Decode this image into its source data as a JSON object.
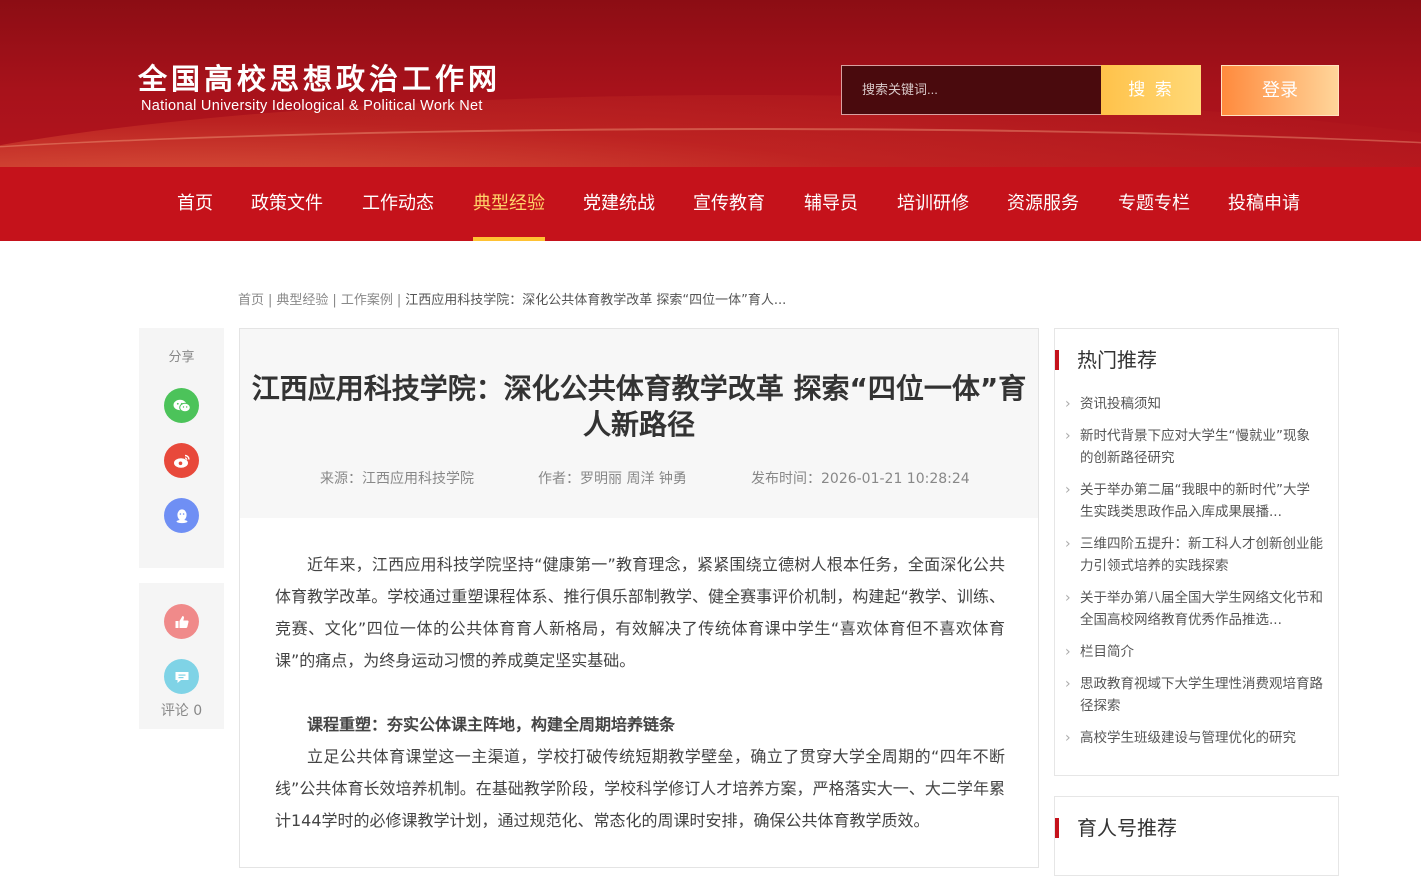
{
  "header": {
    "logo_cn": "全国高校思想政治工作网",
    "logo_en": "National University Ideological & Political Work Net",
    "search_placeholder": "搜索关键词...",
    "search_button": "搜 索",
    "login_button": "登录"
  },
  "nav": {
    "items": [
      "首页",
      "政策文件",
      "工作动态",
      "典型经验",
      "党建统战",
      "宣传教育",
      "辅导员",
      "培训研修",
      "资源服务",
      "专题专栏",
      "投稿申请"
    ],
    "active": "典型经验"
  },
  "breadcrumb": {
    "items": [
      "首页",
      "典型经验",
      "工作案例"
    ],
    "current": "江西应用科技学院：深化公共体育教学改革 探索“四位一体”育人..."
  },
  "share": {
    "label": "分享",
    "icons": [
      "wechat-icon",
      "weibo-icon",
      "qq-icon"
    ],
    "like_icon": "thumbs-up-icon",
    "comment_icon": "comment-icon",
    "comment_label": "评论 0"
  },
  "article": {
    "title": "江西应用科技学院：深化公共体育教学改革 探索“四位一体”育人新路径",
    "source": "来源：江西应用科技学院",
    "author": "作者：罗明丽 周洋 钟勇",
    "published": "发布时间：2026-01-21 10:28:24",
    "paragraphs": [
      "近年来，江西应用科技学院坚持“健康第一”教育理念，紧紧围绕立德树人根本任务，全面深化公共体育教学改革。学校通过重塑课程体系、推行俱乐部制教学、健全赛事评价机制，构建起“教学、训练、竞赛、文化”四位一体的公共体育育人新格局，有效解决了传统体育课中学生“喜欢体育但不喜欢体育课”的痛点，为终身运动习惯的养成奠定坚实基础。",
      "课程重塑：夯实公体课主阵地，构建全周期培养链条",
      "立足公共体育课堂这一主渠道，学校打破传统短期教学壁垒，确立了贯穿大学全周期的“四年不断线”公共体育长效培养机制。在基础教学阶段，学校科学修订人才培养方案，严格落实大一、大二学年累计144学时的必修课教学计划，通过规范化、常态化的周课时安排，确保公共体育教学质效。"
    ]
  },
  "sidebar": {
    "hot_title": "热门推荐",
    "hot_items": [
      "资讯投稿须知",
      "新时代背景下应对大学生“慢就业”现象的创新路径研究",
      "关于举办第二届“我眼中的新时代”大学生实践类思政作品入库成果展播...",
      "三维四阶五提升：新工科人才创新创业能力引领式培养的实践探索",
      "关于举办第八届全国大学生网络文化节和全国高校网络教育优秀作品推选...",
      "栏目简介",
      "思政教育视域下大学生理性消费观培育路径探索",
      "高校学生班级建设与管理优化的研究"
    ],
    "second_title": "育人号推荐"
  },
  "colors": {
    "brand_red": "#c5121b",
    "header_dark_red": "#8c0d14",
    "nav_active": "#ffd36a",
    "search_button": "#ffc24a",
    "login_button": "#ff8a3d",
    "wechat": "#4cc35a",
    "weibo": "#e8493b",
    "qq": "#6f8ff4",
    "like": "#f08a8a",
    "comment": "#7fd3e6"
  }
}
